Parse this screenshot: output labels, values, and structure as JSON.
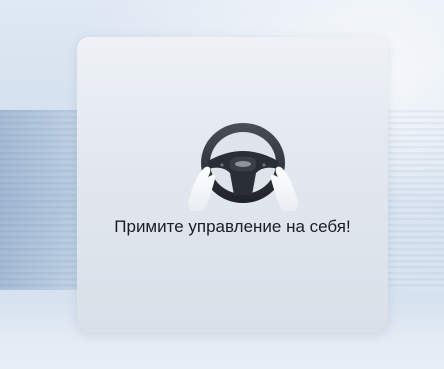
{
  "alert": {
    "icon": "steering-wheel-hands-icon",
    "message": "Примите управление на себя!"
  },
  "colors": {
    "card_background": "#e3e8ef",
    "text": "#1a1d22",
    "wheel": "#2b2f36",
    "hands": "#ffffff"
  }
}
